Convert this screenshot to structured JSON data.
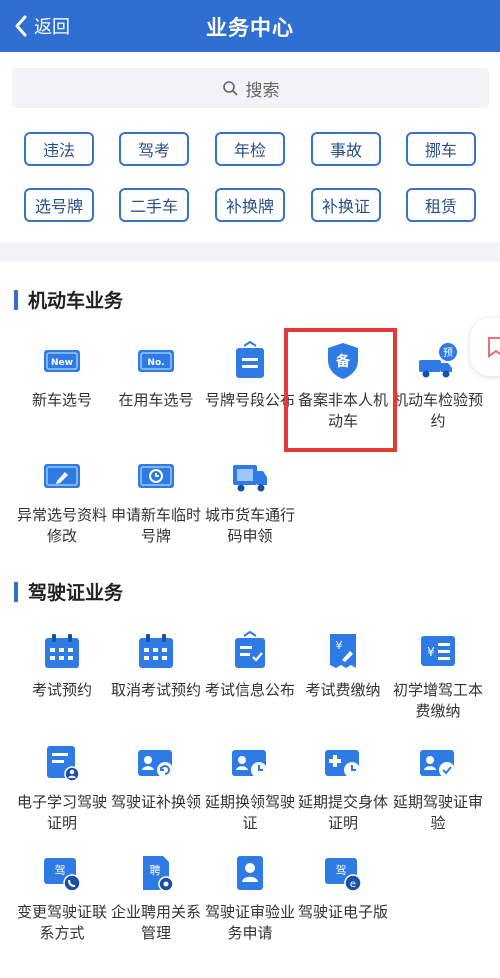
{
  "header": {
    "back_label": "返回",
    "title": "业务中心"
  },
  "search": {
    "placeholder": "搜索"
  },
  "chips": [
    "违法",
    "驾考",
    "年检",
    "事故",
    "挪车",
    "选号牌",
    "二手车",
    "补换牌",
    "补换证",
    "租赁"
  ],
  "sections": {
    "vehicle": {
      "title": "机动车业务",
      "items": [
        {
          "label": "新车选号",
          "icon": "new-plate-icon"
        },
        {
          "label": "在用车选号",
          "icon": "plate-number-icon"
        },
        {
          "label": "号牌号段公布",
          "icon": "announcement-board-icon"
        },
        {
          "label": "备案非本人机动车",
          "icon": "shield-record-icon"
        },
        {
          "label": "机动车检验预约",
          "icon": "truck-reserve-icon"
        },
        {
          "label": "异常选号资料修改",
          "icon": "edit-card-icon"
        },
        {
          "label": "申请新车临时号牌",
          "icon": "timer-plate-icon"
        },
        {
          "label": "城市货车通行码申领",
          "icon": "freight-truck-icon"
        }
      ]
    },
    "license": {
      "title": "驾驶证业务",
      "items": [
        {
          "label": "考试预约",
          "icon": "calendar-icon"
        },
        {
          "label": "取消考试预约",
          "icon": "calendar-cancel-icon"
        },
        {
          "label": "考试信息公布",
          "icon": "info-board-icon"
        },
        {
          "label": "考试费缴纳",
          "icon": "fee-receipt-icon"
        },
        {
          "label": "初学增驾工本费缴纳",
          "icon": "cost-bill-icon"
        },
        {
          "label": "电子学习驾驶证明",
          "icon": "study-doc-icon"
        },
        {
          "label": "驾驶证补换领",
          "icon": "license-renew-icon"
        },
        {
          "label": "延期换领驾驶证",
          "icon": "license-delay-icon"
        },
        {
          "label": "延期提交身体证明",
          "icon": "health-delay-icon"
        },
        {
          "label": "延期驾驶证审验",
          "icon": "license-check-icon"
        },
        {
          "label": "变更驾驶证联系方式",
          "icon": "license-phone-icon"
        },
        {
          "label": "企业聘用关系管理",
          "icon": "employ-doc-icon"
        },
        {
          "label": "驾驶证审验业务申请",
          "icon": "review-apply-icon"
        },
        {
          "label": "驾驶证电子版",
          "icon": "e-license-icon"
        }
      ]
    }
  },
  "colors": {
    "brand": "#2f6fd1",
    "highlight": "#e53935"
  }
}
